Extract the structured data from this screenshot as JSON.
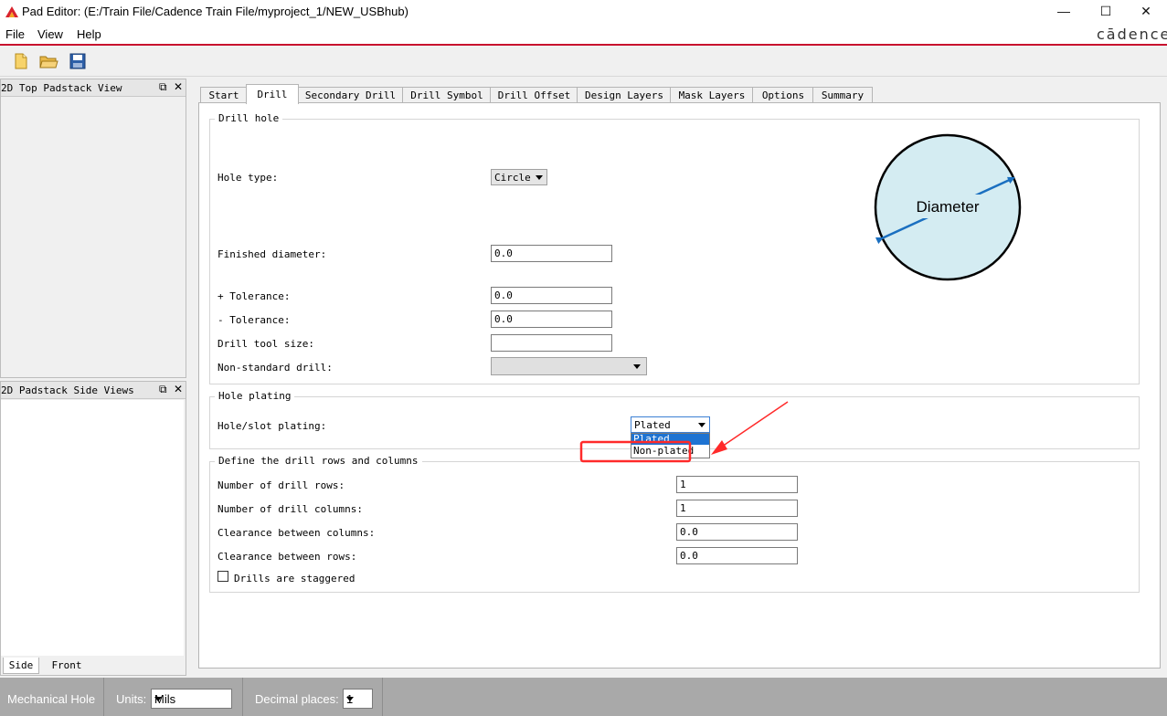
{
  "window": {
    "title": "Pad Editor:   (E:/Train File/Cadence Train File/myproject_1/NEW_USBhub)",
    "min": "—",
    "max": "☐",
    "close": "✕"
  },
  "menu": {
    "file": "File",
    "view": "View",
    "help": "Help",
    "brand": "cādence"
  },
  "panels": {
    "top_view": {
      "title": "2D Top Padstack View",
      "float": "⧉",
      "close": "✕"
    },
    "side_views": {
      "title": "2D Padstack Side Views",
      "float": "⧉",
      "close": "✕"
    },
    "side_tabs": [
      "Side",
      "Front"
    ]
  },
  "tabs": [
    "Start",
    "Drill",
    "Secondary Drill",
    "Drill Symbol",
    "Drill Offset",
    "Design Layers",
    "Mask Layers",
    "Options",
    "Summary"
  ],
  "drill_hole": {
    "title": "Drill hole",
    "hole_type_label": "Hole type:",
    "hole_type_value": "Circle",
    "finished_diameter_label": "Finished diameter:",
    "finished_diameter_value": "0.0",
    "plus_tol_label": "+ Tolerance:",
    "plus_tol_value": "0.0",
    "minus_tol_label": "- Tolerance:",
    "minus_tol_value": "0.0",
    "tool_size_label": "Drill tool size:",
    "tool_size_value": "",
    "nonstd_label": "Non-standard drill:",
    "nonstd_value": "",
    "diagram_label": "Diameter"
  },
  "hole_plating": {
    "title": "Hole plating",
    "label": "Hole/slot plating:",
    "value": "Plated",
    "options": [
      "Plated",
      "Non-plated"
    ]
  },
  "rows_cols": {
    "title": "Define the drill rows and columns",
    "rows_label": "Number of drill rows:",
    "rows_value": "1",
    "cols_label": "Number of drill columns:",
    "cols_value": "1",
    "clear_cols_label": "Clearance between columns:",
    "clear_cols_value": "0.0",
    "clear_rows_label": "Clearance between rows:",
    "clear_rows_value": "0.0",
    "staggered_label": "Drills are staggered",
    "staggered_checked": false
  },
  "status": {
    "mode": "Mechanical Hole",
    "units_label": "Units:",
    "units_value": "Mils",
    "decimal_label": "Decimal places:",
    "decimal_value": "1"
  },
  "colors": {
    "accent_red": "#c8102e",
    "annotation_red": "#ff2a2a",
    "diagram_fill": "#d4ecf2",
    "diagram_arrow": "#1a6fc0",
    "status_bg": "#a9a9a9"
  }
}
